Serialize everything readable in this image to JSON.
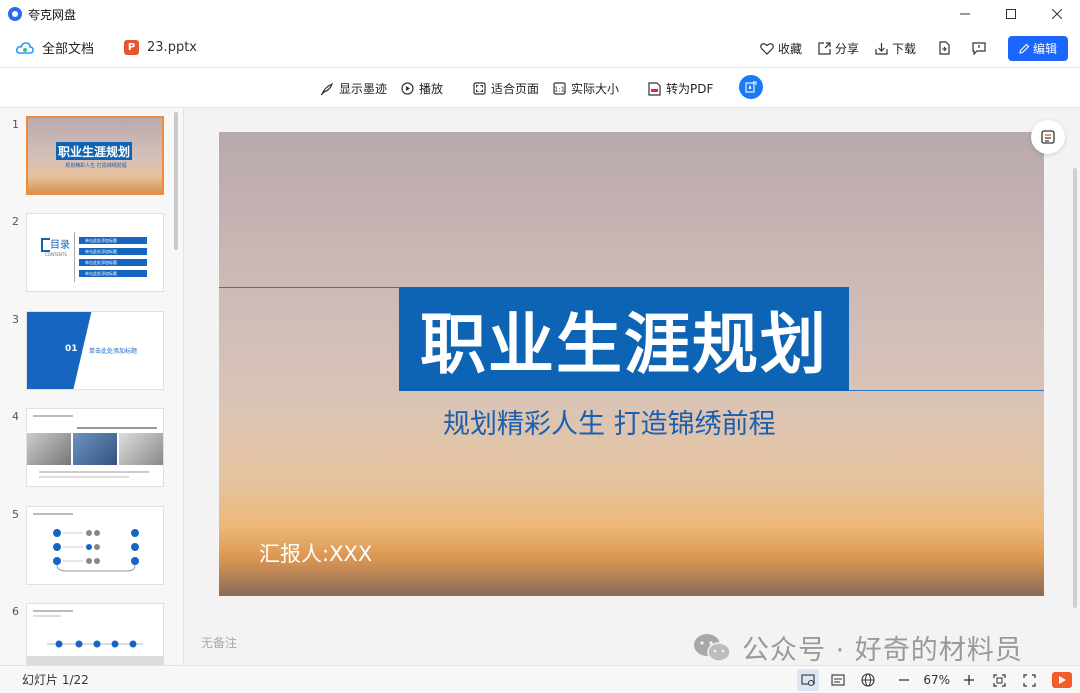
{
  "app": {
    "title": "夸克网盘"
  },
  "docbar": {
    "all_docs": "全部文档",
    "file_icon_letter": "P",
    "file_name": "23.pptx",
    "favorite": "收藏",
    "share": "分享",
    "download": "下载",
    "edit": "编辑"
  },
  "toolbar": {
    "show_ink": "显示墨迹",
    "play": "播放",
    "fit_page": "适合页面",
    "actual_size": "实际大小",
    "to_pdf": "转为PDF"
  },
  "thumbnails": {
    "items": [
      {
        "num": "1",
        "title": "职业生涯规划",
        "sub": "规划精彩人生 打造锦绣前程"
      },
      {
        "num": "2",
        "title": "目录",
        "en": "CONTENTS",
        "rows": [
          "单击此处添加标题",
          "单击此处添加标题",
          "单击此处添加标题",
          "单击此处添加标题"
        ]
      },
      {
        "num": "3",
        "badge": "01",
        "label": "单击此处添加标题"
      },
      {
        "num": "4"
      },
      {
        "num": "5"
      },
      {
        "num": "6"
      }
    ]
  },
  "slide": {
    "title": "职业生涯规划",
    "subtitle": "规划精彩人生 打造锦绣前程",
    "reporter": "汇报人:XXX",
    "notes": "无备注"
  },
  "watermark": {
    "text": "公众号 · 好奇的材料员"
  },
  "status": {
    "slide_count": "幻灯片 1/22",
    "zoom": "67%"
  },
  "colors": {
    "accent": "#1a66ff",
    "slide_blue": "#0e64b4",
    "ppt_orange": "#e4572e",
    "active_thumb": "#f08a3c"
  }
}
